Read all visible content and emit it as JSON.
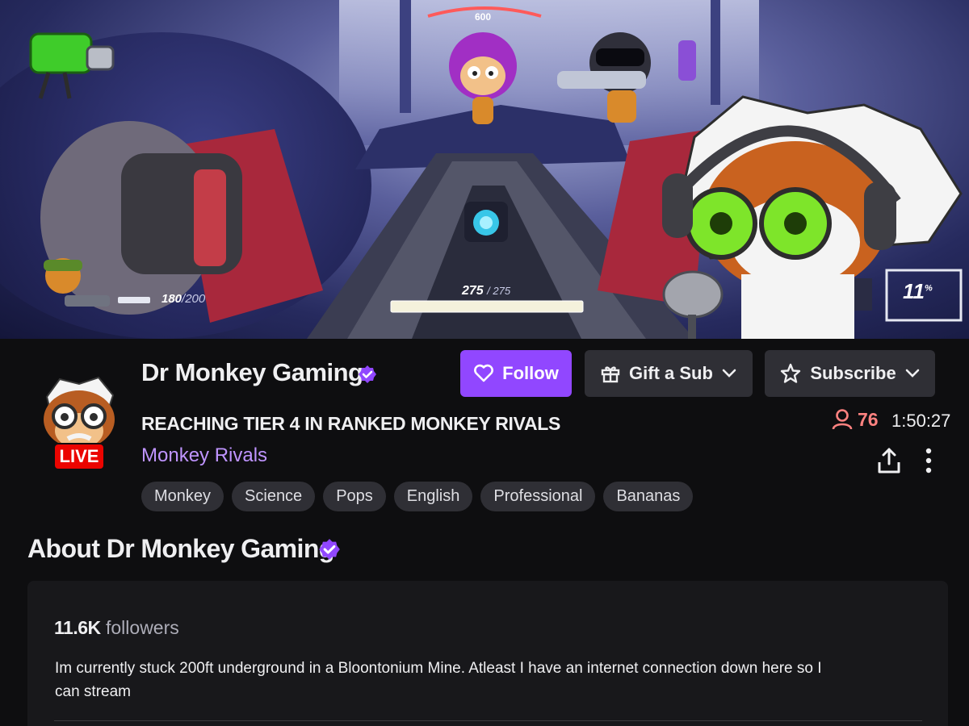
{
  "hud": {
    "ammo": "180",
    "ammo_max": "/200",
    "health": "275",
    "health_max": "/ 275",
    "top_value": "600",
    "percent": "11"
  },
  "channel": {
    "name": "Dr Monkey Gaming",
    "live_label": "LIVE",
    "stream_title": "REACHING TIER 4 IN RANKED MONKEY RIVALS",
    "category": "Monkey Rivals",
    "tags": [
      "Monkey",
      "Science",
      "Pops",
      "English",
      "Professional",
      "Bananas"
    ],
    "viewer_count": "76",
    "uptime": "1:50:27"
  },
  "actions": {
    "follow_label": "Follow",
    "gift_label": "Gift a Sub",
    "subscribe_label": "Subscribe"
  },
  "about": {
    "title": "About Dr Monkey Gaming",
    "followers_count": "11.6K",
    "followers_label": "followers",
    "bio": "Im currently stuck 200ft underground in a Bloontonium Mine. Atleast I have an internet connection down here so I can stream"
  },
  "colors": {
    "accent": "#9147ff",
    "live": "#eb0400",
    "viewers": "#ff8280",
    "category": "#bf94ff",
    "background": "#0e0e10"
  },
  "icons": [
    "heart-icon",
    "gift-icon",
    "chevron-down-icon",
    "star-icon",
    "viewer-icon",
    "share-icon",
    "more-icon",
    "verified-icon"
  ]
}
